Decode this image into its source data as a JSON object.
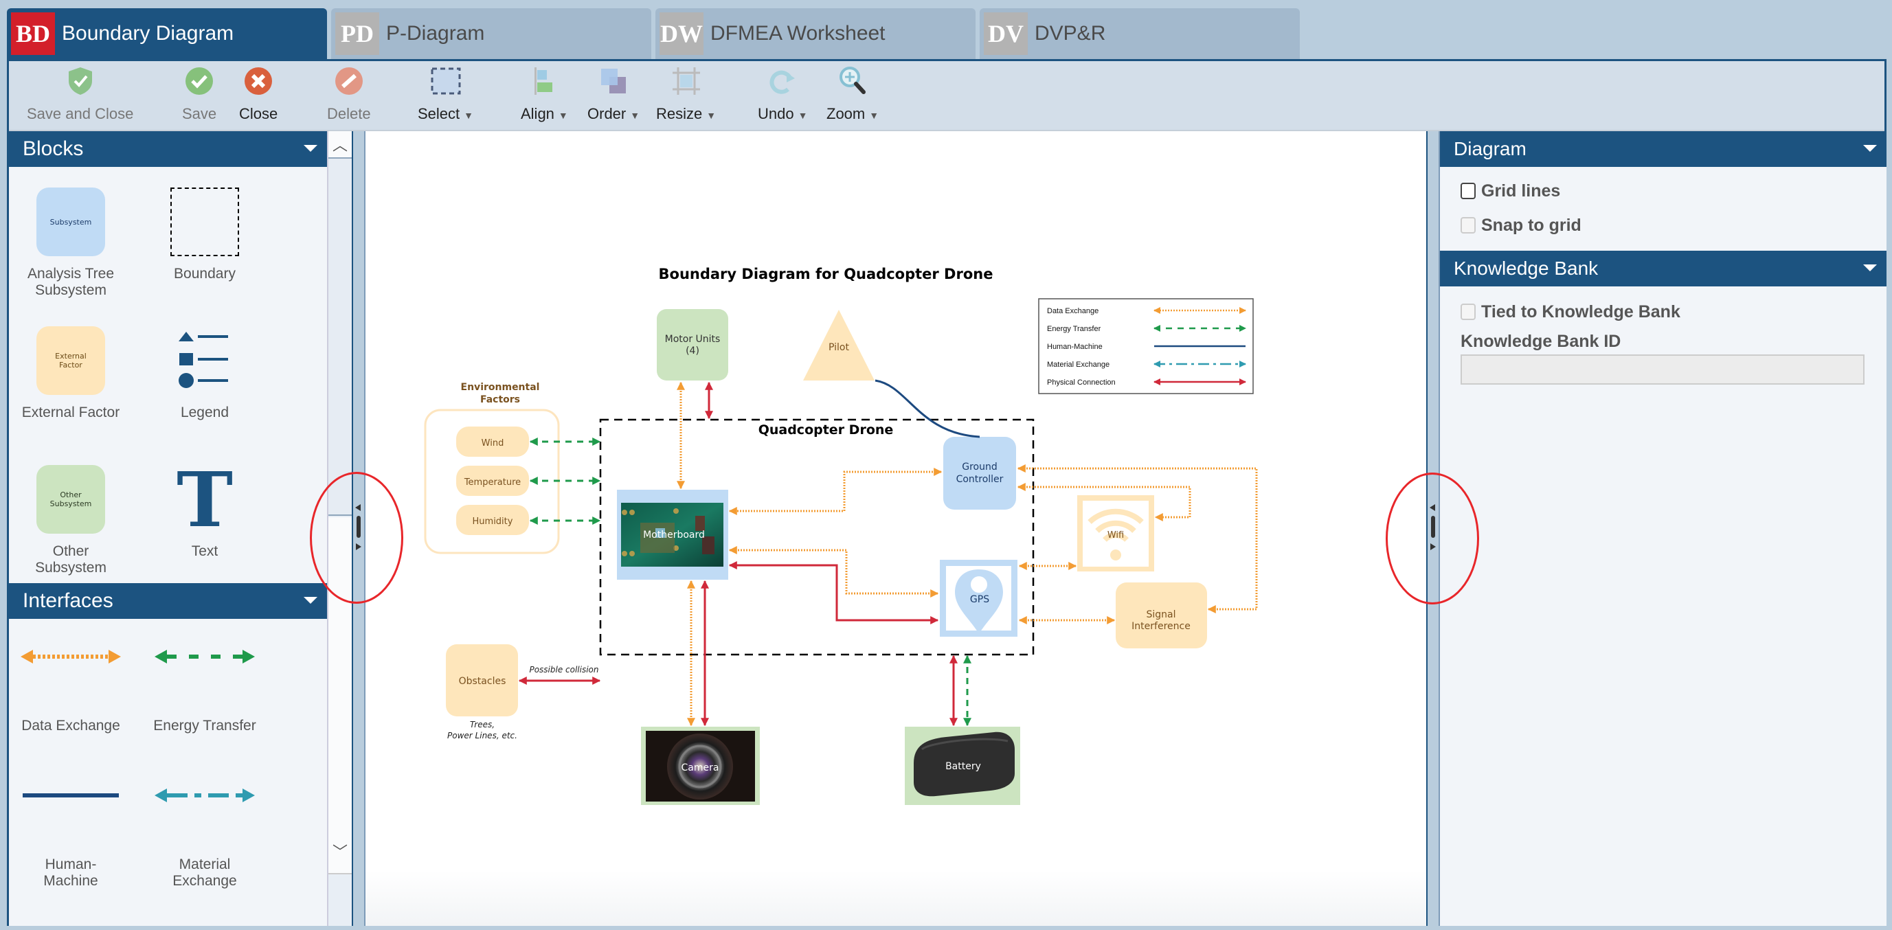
{
  "tabs": [
    {
      "abbr": "BD",
      "label": "Boundary Diagram",
      "active": true
    },
    {
      "abbr": "PD",
      "label": "P-Diagram",
      "active": false
    },
    {
      "abbr": "DW",
      "label": "DFMEA Worksheet",
      "active": false
    },
    {
      "abbr": "DV",
      "label": "DVP&R",
      "active": false
    }
  ],
  "toolbar": {
    "save_and_close": "Save and Close",
    "save": "Save",
    "close": "Close",
    "delete": "Delete",
    "select": "Select",
    "align": "Align",
    "order": "Order",
    "resize": "Resize",
    "undo": "Undo",
    "zoom": "Zoom"
  },
  "left_panel": {
    "blocks_title": "Blocks",
    "blocks": [
      {
        "label": "Analysis Tree Subsystem",
        "swatch_text": "Subsystem"
      },
      {
        "label": "Boundary"
      },
      {
        "label": "External Factor",
        "swatch_text": "External Factor"
      },
      {
        "label": "Legend"
      },
      {
        "label": "Other Subsystem",
        "swatch_text": "Other Subsystem"
      },
      {
        "label": "Text",
        "glyph": "T"
      }
    ],
    "interfaces_title": "Interfaces",
    "interfaces": [
      {
        "label": "Data Exchange",
        "color": "#f39c33"
      },
      {
        "label": "Energy Transfer",
        "color": "#1f9a4b"
      },
      {
        "label": "Human-Machine",
        "color": "#1d4a80"
      },
      {
        "label": "Material Exchange",
        "color": "#2f9bb0"
      }
    ]
  },
  "right_panel": {
    "diagram_title": "Diagram",
    "grid_lines": {
      "label": "Grid lines",
      "checked": false
    },
    "snap_to_grid": {
      "label": "Snap to grid",
      "checked": false,
      "disabled": true
    },
    "kb_title": "Knowledge Bank",
    "tied_to_kb": {
      "label": "Tied to Knowledge Bank",
      "checked": false,
      "disabled": true
    },
    "kb_id_label": "Knowledge Bank ID",
    "kb_id_value": ""
  },
  "diagram": {
    "title": "Boundary Diagram for Quadcopter Drone",
    "boundary_label": "Quadcopter Drone",
    "env_group_label": "Environmental Factors",
    "nodes": {
      "motor_units": "Motor Units (4)",
      "pilot": "Pilot",
      "wind": "Wind",
      "temperature": "Temperature",
      "humidity": "Humidity",
      "motherboard": "Motherboard",
      "ground_controller": "Ground Controller",
      "wifi": "Wifi",
      "gps": "GPS",
      "signal_interference": "Signal Interference",
      "obstacles": "Obstacles",
      "obstacles_note": "Trees, Power Lines, etc.",
      "camera": "Camera",
      "battery": "Battery"
    },
    "collision_label": "Possible collision",
    "legend": [
      {
        "label": "Data Exchange",
        "color": "#f39c33"
      },
      {
        "label": "Energy Transfer",
        "color": "#1f9a4b"
      },
      {
        "label": "Human-Machine",
        "color": "#1d4a80"
      },
      {
        "label": "Material Exchange",
        "color": "#2f9bb0"
      },
      {
        "label": "Physical Connection",
        "color": "#d0293a"
      }
    ]
  },
  "colors": {
    "brand": "#1c5380",
    "active_tab_badge": "#d31f2a",
    "subsystem": "#c0dbf5",
    "external": "#fee6bb",
    "other": "#cce4c0"
  }
}
